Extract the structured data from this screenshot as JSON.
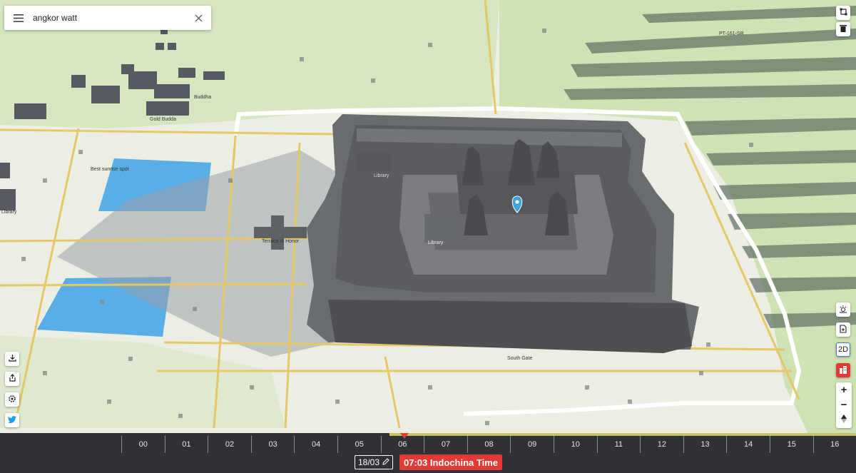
{
  "search": {
    "value": "angkor watt"
  },
  "map_labels": {
    "buddha": "Buddha",
    "gold_budda": "Gold Budda",
    "best_sunrise": "Best sunrise spot",
    "library_west": "Library",
    "library_center": "Library",
    "library_north": "Library",
    "terrace": "Terrace of Honor",
    "south_gate": "South Gate",
    "pt": "PT-161-SR"
  },
  "controls": {
    "mode_2d": "2D",
    "zoom_in": "+",
    "zoom_out": "−"
  },
  "timeline": {
    "hours": [
      "00",
      "01",
      "02",
      "03",
      "04",
      "05",
      "06",
      "07",
      "08",
      "09",
      "10",
      "11",
      "12",
      "13",
      "14",
      "15",
      "16"
    ],
    "date": "18/03",
    "time": "07:03 Indochina Time",
    "progress_hour": 7.05
  },
  "colors": {
    "accent": "#e53935",
    "pin": "#3ba3d9",
    "water": "#5aaee6"
  }
}
